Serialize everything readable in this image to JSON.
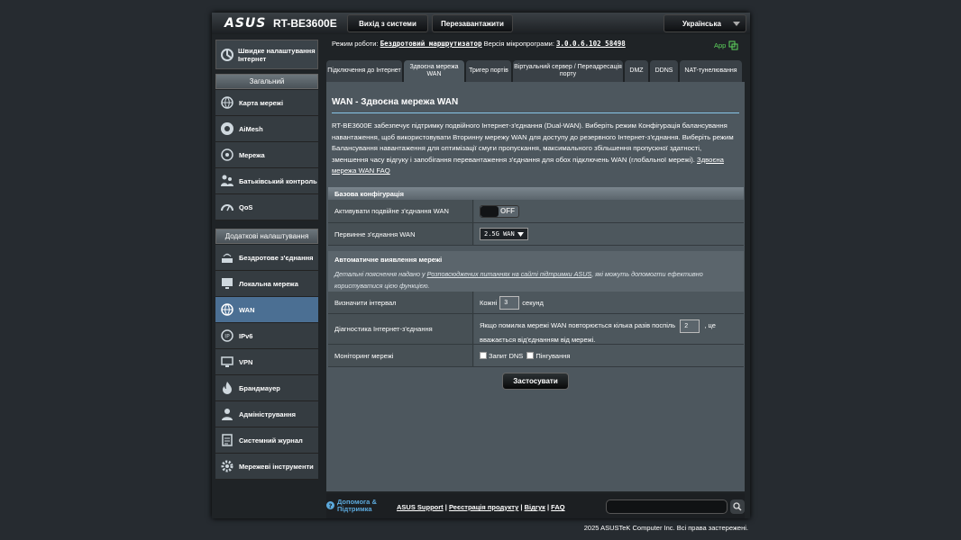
{
  "header": {
    "brand": "ASUS",
    "model": "RT-BE3600E",
    "logout_label": "Вихід з системи",
    "reboot_label": "Перезавантажити",
    "language": "Українська"
  },
  "status": {
    "mode_label": "Режим роботи:",
    "mode_value": "Бездротовий маршрутизатор",
    "fw_label": "Версія мікропрограми:",
    "fw_value": "3.0.0.6.102_58498",
    "app_label": "App"
  },
  "sidebar": {
    "quick_setup": "Швидке налаштування Інтернет",
    "general_title": "Загальний",
    "general_items": [
      "Карта мережі",
      "AiMesh",
      "Мережа",
      "Батьківський контроль",
      "QoS"
    ],
    "advanced_title": "Додаткові налаштування",
    "advanced_items": [
      "Бездротове з'єднання",
      "Локальна мережа",
      "WAN",
      "IPv6",
      "VPN",
      "Брандмауер",
      "Адміністрування",
      "Системний журнал",
      "Мережеві інструменти"
    ]
  },
  "tabs": [
    "Підключення до Інтернет",
    "Здвоєна мережа WAN",
    "Тригер портів",
    "Віртуальний сервер / Переадресація порту",
    "DMZ",
    "DDNS",
    "NAT-тунелювання"
  ],
  "content": {
    "title": "WAN - Здвоєна мережа WAN",
    "description": "RT-BE3600E забезпечує підтримку подвійного Інтернет-з'єднання (Dual-WAN). Виберіть режим Конфігурація балансування навантаження, щоб використовувати Вторинну мережу WAN для доступу до резервного Інтернет-з'єднання. Виберіть режим Балансування навантаження для оптимізації смуги пропускання, максимального збільшення пропускної здатності, зменшення часу відгуку і запобігання перевантаження з'єднання для обох підключень WAN (глобальної мережі).",
    "faq_link": "Здвоєна мережа WAN FAQ",
    "basic_title": "Базова конфігурація",
    "enable_dual_label": "Активувати подвійне з'єднання WAN",
    "toggle_state": "OFF",
    "primary_label": "Первинне з'єднання WAN",
    "primary_value": "2.5G WAN",
    "auto_title": "Автоматичне виявлення мережі",
    "auto_desc_1": "Детальні пояснення надано у",
    "auto_desc_link": "Розповсюджених питаннях на сайті підтримки ASUS",
    "auto_desc_2": ", які можуть допомогти ефективно",
    "auto_desc_3": "користуватися цією функцією.",
    "interval_label": "Визначити інтервал",
    "interval_pre": "Кожні",
    "interval_value": "3",
    "interval_post": "секунд",
    "diag_label": "Діагностика Інтернет-з'єднання",
    "diag_pre": "Якщо помилка мережі WAN повторюється кілька разів поспіль",
    "diag_value": "2",
    "diag_post": ", це",
    "diag_line2": "вважається від'єднанням від мережі.",
    "monitor_label": "Моніторинг мережі",
    "dns_label": "Запит DNS",
    "ping_label": "Пінгування",
    "apply_label": "Застосувати"
  },
  "footer": {
    "help": "Допомога & Підтримка",
    "support": "ASUS Support",
    "register": "Реєстрація продукту",
    "feedback": "Відгук",
    "faq": "FAQ",
    "sep": "|",
    "copyright": "2025 ASUSTeK Computer Inc. Всі права застережені."
  },
  "colors": {
    "active": "#4b6f93",
    "accent": "#88c5e8",
    "app": "#5dd35d"
  }
}
